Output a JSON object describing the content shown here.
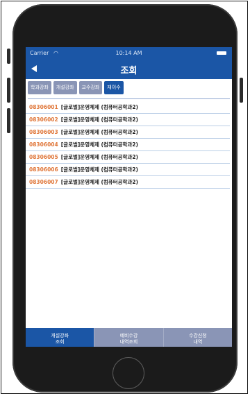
{
  "status_bar": {
    "carrier": "Carrier",
    "wifi_icon": "wifi-icon",
    "time": "10:14 AM",
    "battery_icon": "battery-icon"
  },
  "nav": {
    "title": "조회",
    "back_icon": "back-arrow-icon"
  },
  "tabs": [
    {
      "label": "학과강좌",
      "active": false
    },
    {
      "label": "개설강좌",
      "active": false
    },
    {
      "label": "교수강좌",
      "active": false
    },
    {
      "label": "재이수",
      "active": true
    }
  ],
  "courses": [
    {
      "code": "08306001",
      "title": "[글로벌]운영체제 (컴퓨터공학과2)"
    },
    {
      "code": "08306002",
      "title": "[글로벌]운영체제 (컴퓨터공학과2)"
    },
    {
      "code": "08306003",
      "title": "[글로벌]운영체제 (컴퓨터공학과2)"
    },
    {
      "code": "08306004",
      "title": "[글로벌]운영체제 (컴퓨터공학과2)"
    },
    {
      "code": "08306005",
      "title": "[글로벌]운영체제 (컴퓨터공학과2)"
    },
    {
      "code": "08306006",
      "title": "[글로벌]운영체제 (컴퓨터공학과2)"
    },
    {
      "code": "08306007",
      "title": "[글로벌]운영체제 (컴퓨터공학과2)"
    }
  ],
  "bottom_tabs": [
    {
      "line1": "개설강좌",
      "line2": "조회"
    },
    {
      "line1": "예비수강",
      "line2": "내역조회"
    },
    {
      "line1": "수강신청",
      "line2": "내역"
    }
  ],
  "colors": {
    "header": "#1b56a6",
    "tab_inactive": "#8a95b6",
    "code": "#e0773a"
  }
}
